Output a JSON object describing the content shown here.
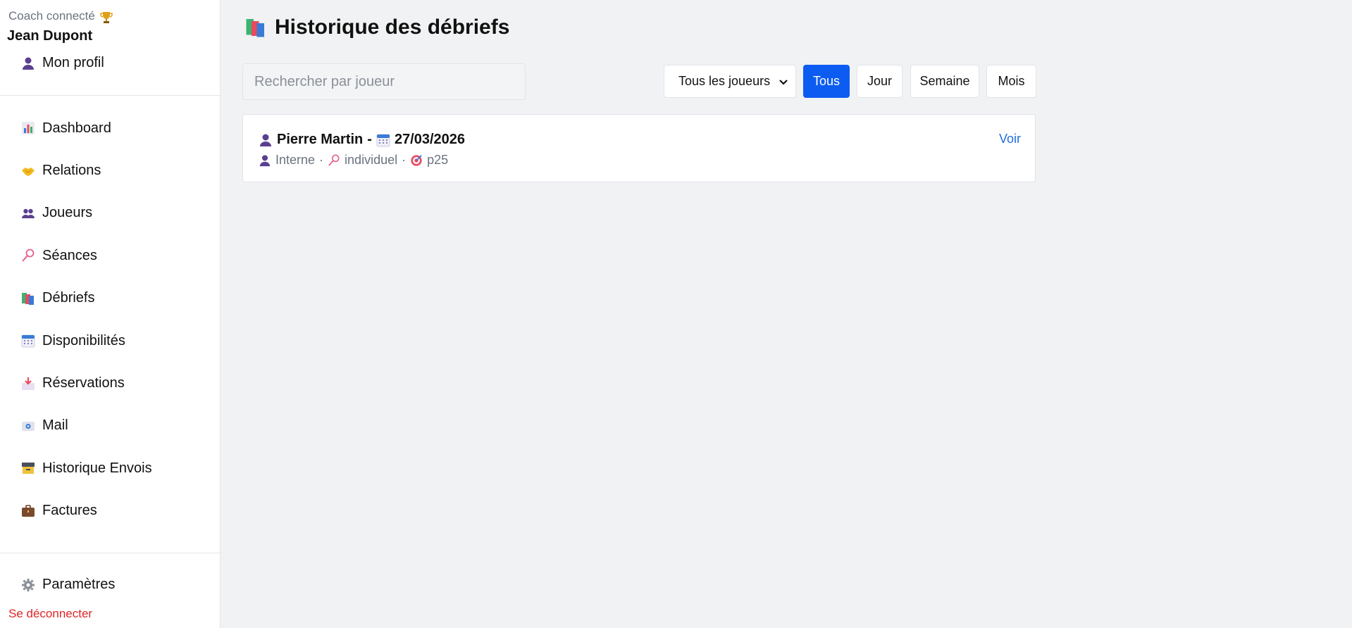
{
  "sidebar": {
    "coach_label": "Coach connecté",
    "coach_name": "Jean Dupont",
    "profile_label": "Mon profil",
    "items": [
      {
        "label": "Dashboard",
        "icon": "bar-chart-icon"
      },
      {
        "label": "Relations",
        "icon": "handshake-icon"
      },
      {
        "label": "Joueurs",
        "icon": "users-icon"
      },
      {
        "label": "Séances",
        "icon": "racket-icon"
      },
      {
        "label": "Débriefs",
        "icon": "books-icon"
      },
      {
        "label": "Disponibilités",
        "icon": "calendar-icon"
      },
      {
        "label": "Réservations",
        "icon": "inbox-icon"
      },
      {
        "label": "Mail",
        "icon": "mail-icon"
      },
      {
        "label": "Historique Envois",
        "icon": "archive-icon"
      },
      {
        "label": "Factures",
        "icon": "briefcase-icon"
      }
    ],
    "settings_label": "Paramètres",
    "logout_label": "Se déconnecter"
  },
  "main": {
    "title": "Historique des débriefs",
    "search_placeholder": "Rechercher par joueur",
    "player_filter": "Tous les joueurs",
    "period_buttons": [
      "Tous",
      "Jour",
      "Semaine",
      "Mois"
    ],
    "active_period": "Tous",
    "debriefs": [
      {
        "player": "Pierre Martin",
        "separator": "-",
        "date": "27/03/2026",
        "type": "Interne",
        "format": "individuel",
        "target": "p25",
        "action_label": "Voir"
      }
    ]
  },
  "colors": {
    "accent": "#0d5cf2",
    "link": "#1e6fe0",
    "logout": "#dc2626",
    "background": "#f1f2f4"
  }
}
